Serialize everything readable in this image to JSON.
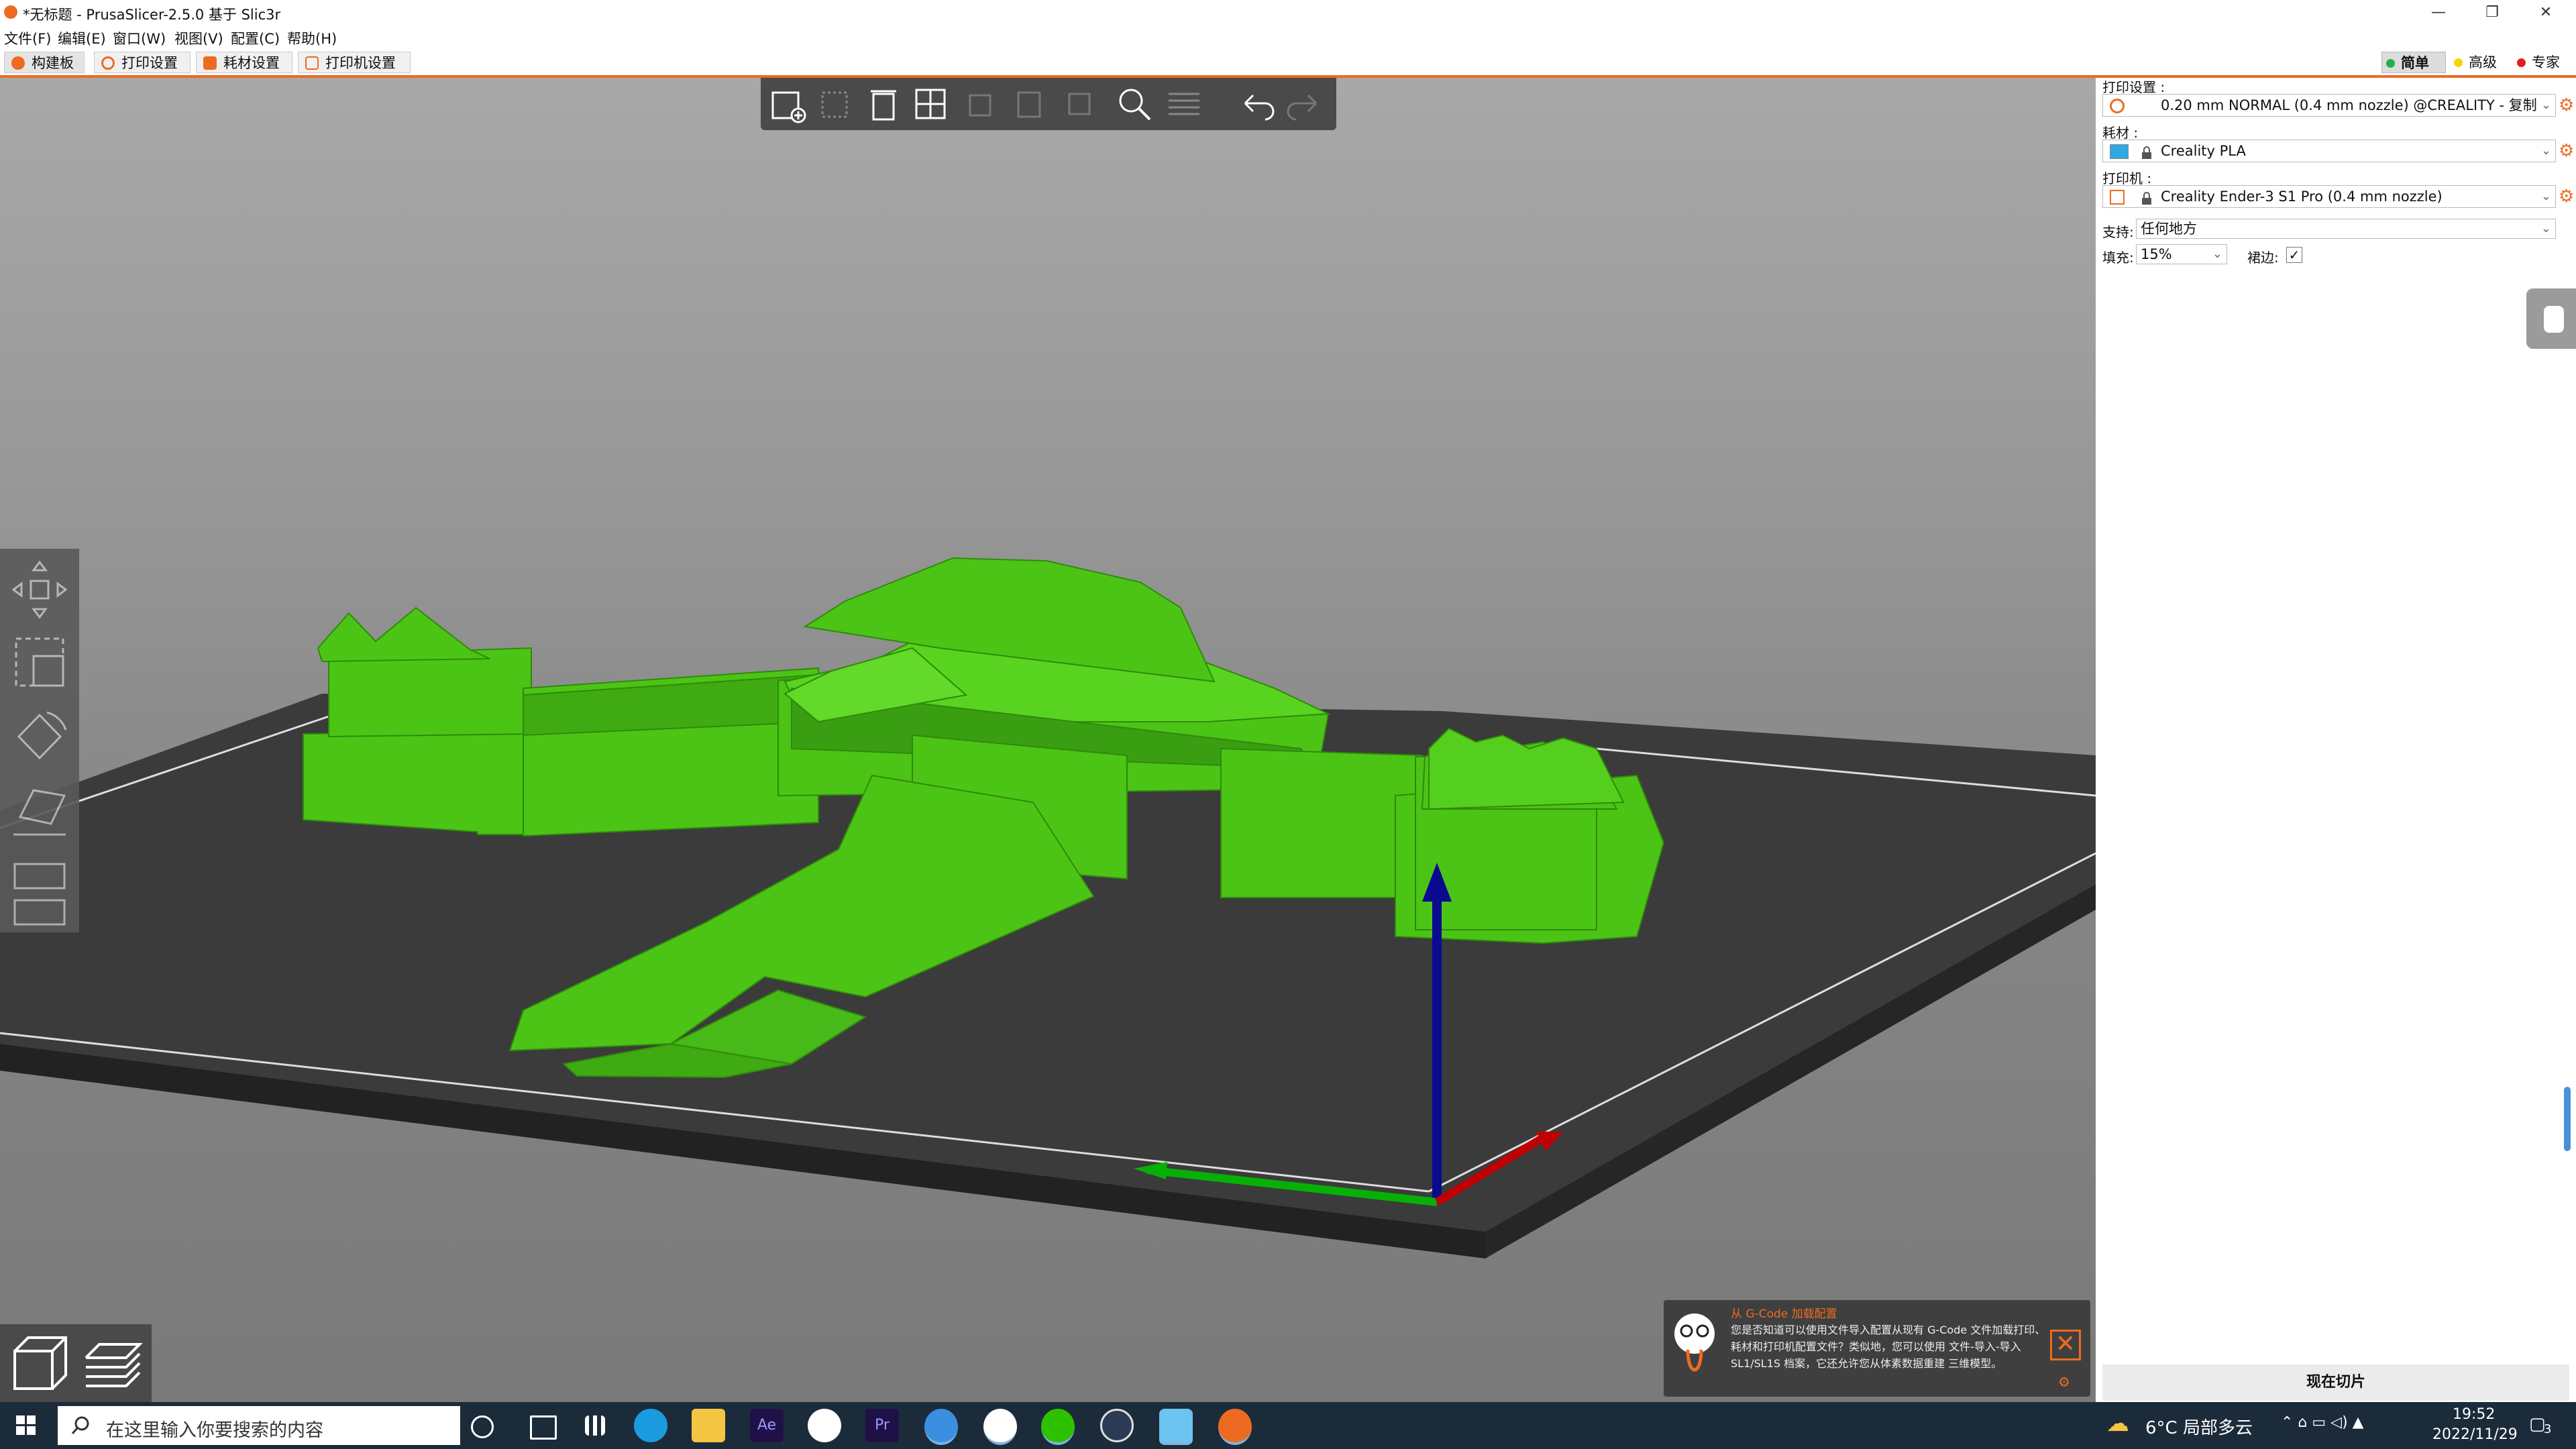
{
  "window": {
    "title": "*无标题 - PrusaSlicer-2.5.0 基于 Slic3r",
    "controls": [
      "—",
      "❐",
      "✕"
    ]
  },
  "menu": [
    "文件(F)",
    "编辑(E)",
    "窗口(W)",
    "视图(V)",
    "配置(C)",
    "帮助(H)"
  ],
  "tabs": [
    {
      "label": "构建板",
      "icon": "plater-icon",
      "active": true
    },
    {
      "label": "打印设置",
      "icon": "gear-icon",
      "active": false
    },
    {
      "label": "耗材设置",
      "icon": "spool-icon",
      "active": false
    },
    {
      "label": "打印机设置",
      "icon": "printer-icon",
      "active": false
    }
  ],
  "modes": [
    {
      "label": "简单",
      "color": "#22b14c",
      "active": true
    },
    {
      "label": "高级",
      "color": "#f7d600",
      "active": false
    },
    {
      "label": "专家",
      "color": "#e02020",
      "active": false
    }
  ],
  "toolbar": {
    "buttons": [
      "add-object-icon",
      "delete-icon",
      "delete-all-icon",
      "arrange-icon",
      "copy-icon",
      "paste-icon",
      "add-instance-icon",
      "search-icon",
      "layers-icon",
      "undo-icon",
      "redo-icon"
    ]
  },
  "sidebar": {
    "print_settings_label": "打印设置 :",
    "print_settings_value": "0.20 mm NORMAL (0.4 mm nozzle) @CREALITY - 复制",
    "filament_label": "耗材 :",
    "filament_value": "Creality PLA",
    "filament_color": "#32a8e0",
    "printer_label": "打印机 :",
    "printer_value": "Creality Ender-3 S1 Pro (0.4 mm nozzle)",
    "support_label": "支持:",
    "support_value": "任何地方",
    "infill_label": "填充:",
    "infill_value": "15%",
    "brim_label": "裙边:",
    "brim_checked": true,
    "slice_button": "现在切片"
  },
  "notification": {
    "title": "从 G-Code 加载配置",
    "text": "您是否知道可以使用文件导入配置从现有 G-Code 文件加载打印、耗材和打印机配置文件？类似地，您可以使用 文件-导入-导入 SL1/SL1S 档案，它还允许您从体素数据重建 三维模型。"
  },
  "taskbar": {
    "search_placeholder": "在这里输入你要搜索的内容",
    "weather": "6°C 局部多云",
    "time": "19:52",
    "date": "2022/11/29",
    "notif_count": "3"
  },
  "colors": {
    "accent": "#ed6b21",
    "model": "#4cc416",
    "bed": "#3b3b3b",
    "axis_x": "#c00000",
    "axis_y": "#00b000",
    "axis_z": "#0000a0"
  }
}
